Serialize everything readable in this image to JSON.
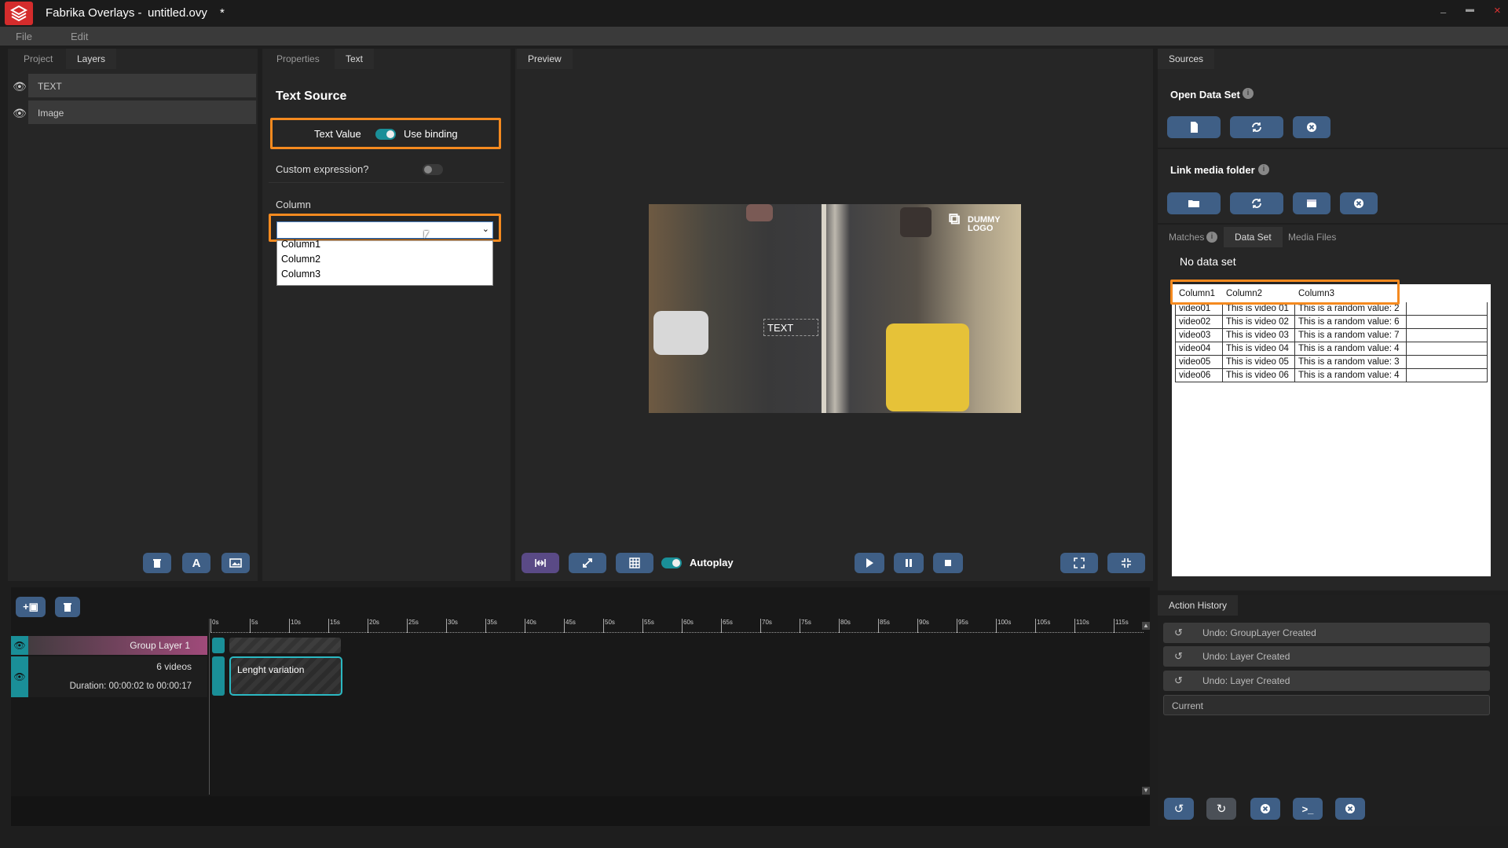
{
  "titlebar": {
    "app": "Fabrika Overlays -",
    "file": "untitled.ovy",
    "modified": "*",
    "minimize": "–",
    "maximize": "▬",
    "close": "×"
  },
  "menu": [
    "File",
    "Edit"
  ],
  "left_tabs": [
    "Project",
    "Layers"
  ],
  "layers": [
    {
      "name": "TEXT"
    },
    {
      "name": "Image"
    }
  ],
  "mid_tabs": [
    "Properties",
    "Text"
  ],
  "text_source": {
    "heading": "Text Source",
    "text_value_label": "Text Value",
    "use_binding_label": "Use binding",
    "custom_expr_label": "Custom expression?",
    "column_label": "Column",
    "column_selected": "",
    "column_options": [
      "Column1",
      "Column2",
      "Column3"
    ]
  },
  "preview": {
    "tab": "Preview",
    "overlay_text": "TEXT",
    "logo_line1": "DUMMY",
    "logo_line2": "LOGO",
    "autoplay_label": "Autoplay"
  },
  "sources": {
    "tab": "Sources",
    "open_data_set": "Open Data Set",
    "link_media_folder": "Link media folder",
    "sub_tabs": [
      "Matches",
      "Data Set",
      "Media Files"
    ],
    "no_data": "No data set",
    "table_headers": [
      "Column1",
      "Column2",
      "Column3"
    ],
    "table_rows": [
      [
        "video01",
        "This is video 01",
        "This is a random value: 2"
      ],
      [
        "video02",
        "This is video 02",
        "This is a random value: 6"
      ],
      [
        "video03",
        "This is video 03",
        "This is a random value: 7"
      ],
      [
        "video04",
        "This is video 04",
        "This is a random value: 4"
      ],
      [
        "video05",
        "This is video 05",
        "This is a random value: 3"
      ],
      [
        "video06",
        "This is video 06",
        "This is a random value: 4"
      ]
    ]
  },
  "timeline": {
    "group_name": "Group Layer 1",
    "video_count": "6 videos",
    "duration": "Duration: 00:00:02 to 00:00:17",
    "clip_label": "Lenght variation",
    "ruler_labels": [
      "0s",
      "5s",
      "10s",
      "15s",
      "20s",
      "25s",
      "30s",
      "35s",
      "40s",
      "45s",
      "50s",
      "55s",
      "60s",
      "65s",
      "70s",
      "75s",
      "80s",
      "85s",
      "90s",
      "95s",
      "100s",
      "105s",
      "110s",
      "115s"
    ]
  },
  "action_history": {
    "tab": "Action History",
    "items": [
      "Undo: GroupLayer Created",
      "Undo: Layer Created",
      "Undo: Layer Created"
    ],
    "current": "Current"
  },
  "colors": {
    "accent_teal": "#1a8f98",
    "highlight_orange": "#f58a1f",
    "button_blue": "#3f5f86",
    "logo_red": "#d42c2c"
  }
}
